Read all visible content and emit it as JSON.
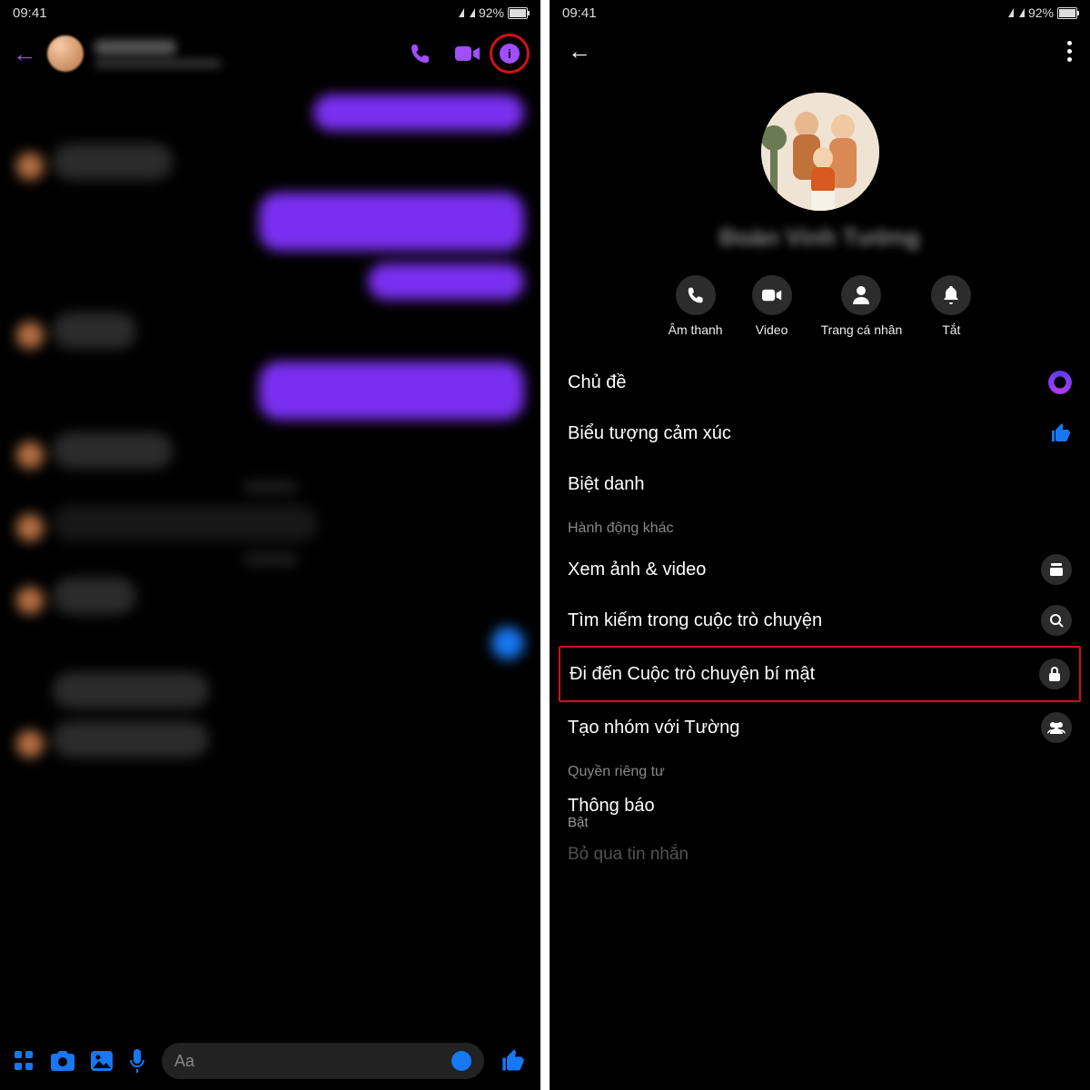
{
  "status": {
    "time": "09:41",
    "battery": "92%"
  },
  "left": {
    "contact_name": "Tường",
    "input_placeholder": "Aa"
  },
  "right": {
    "profile_name": "Đoàn Vinh Tường",
    "actions": {
      "audio": "Âm thanh",
      "video": "Video",
      "profile": "Trang cá nhân",
      "mute": "Tắt"
    },
    "items": {
      "theme": "Chủ đề",
      "emoji": "Biểu tượng cảm xúc",
      "nickname": "Biệt danh",
      "more_actions": "Hành động khác",
      "media": "Xem ảnh & video",
      "search": "Tìm kiếm trong cuộc trò chuyện",
      "secret": "Đi đến Cuộc trò chuyện bí mật",
      "create_group": "Tạo nhóm với Tường",
      "privacy": "Quyền riêng tư",
      "notifications": "Thông báo",
      "notifications_state": "Bật",
      "ignore": "Bỏ qua tin nhắn"
    }
  }
}
